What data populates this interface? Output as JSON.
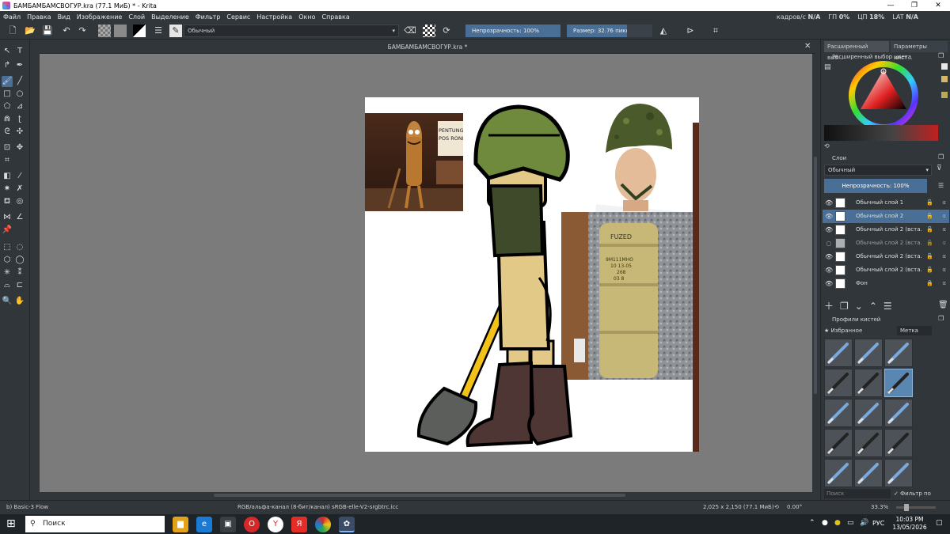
{
  "window": {
    "title": "БАМБАМБАМСВОГУР.kra (77.1 МиБ)  * - Krita",
    "controls": [
      "—",
      "❐",
      "✕"
    ]
  },
  "menu": {
    "items": [
      "Файл",
      "Правка",
      "Вид",
      "Изображение",
      "Слой",
      "Выделение",
      "Фильтр",
      "Сервис",
      "Настройка",
      "Окно",
      "Справка"
    ],
    "stats": {
      "fps_label": "кадров/с",
      "fps_value": "N/A",
      "gpu_label": "ГП",
      "gpu_value": "0%",
      "cpu_label": "ЦП",
      "cpu_value": "18%",
      "lat_label": "LAT",
      "lat_value": "N/A"
    }
  },
  "toolbar": {
    "blend_mode": "Обычный",
    "opacity_label": "Непрозрачность: 100%",
    "opacity": 1.0,
    "size_label": "Размер: 32.76 пикс.",
    "size_fill": 0.7
  },
  "document": {
    "tab_title": "БАМБАМБАМСВОГУР.kra *",
    "poster_text": [
      "PENTUNGA",
      "POS RONDA"
    ],
    "tube_text": [
      "FUZED",
      "9М111МНО",
      "10 13-05",
      "268",
      "03 8"
    ]
  },
  "docker": {
    "tab_1": "Расширенный выб...",
    "tab_2": "Параметры инст...",
    "color_panel_title": "Расширенный выбор цвета",
    "layers_title": "Слои",
    "layers_blend": "Обычный",
    "layers_opacity_label": "Непрозрачность:  100%",
    "layers_opacity": 1.0,
    "layers": [
      {
        "name": "Обычный слой 1",
        "visible": true,
        "selected": false,
        "locked": false
      },
      {
        "name": "Обычный слой 2",
        "visible": true,
        "selected": true,
        "locked": false
      },
      {
        "name": "Обычный слой 2 (вста...",
        "visible": true,
        "selected": false,
        "locked": false
      },
      {
        "name": "Обычный слой 2 (вста...",
        "visible": false,
        "selected": false,
        "locked": false
      },
      {
        "name": "Обычный слой 2 (вста...",
        "visible": true,
        "selected": false,
        "locked": false
      },
      {
        "name": "Обычный слой 2 (вста...",
        "visible": true,
        "selected": false,
        "locked": false
      },
      {
        "name": "Фон",
        "visible": true,
        "selected": false,
        "locked": true
      }
    ],
    "brushes_title": "Профили кистей",
    "brushes_filter": "★ Избранное",
    "brushes_tag": "Метка",
    "search_placeholder": "Поиск",
    "filter_by_tag": "Фильтр по метке"
  },
  "status": {
    "brush": "b) Basic-3 Flow",
    "color_space": "RGB/альфа-канал (8-бит/канал)  sRGB-elle-V2-srgbtrc.icc",
    "dimensions": "2,025 x 2,150 (77.1 МиБ)",
    "rotation": "0.00°",
    "zoom": "33.3%"
  },
  "taskbar": {
    "search_placeholder": "Поиск",
    "language": "РУС",
    "time": "10:03 PM",
    "date": "13/05/2026"
  }
}
